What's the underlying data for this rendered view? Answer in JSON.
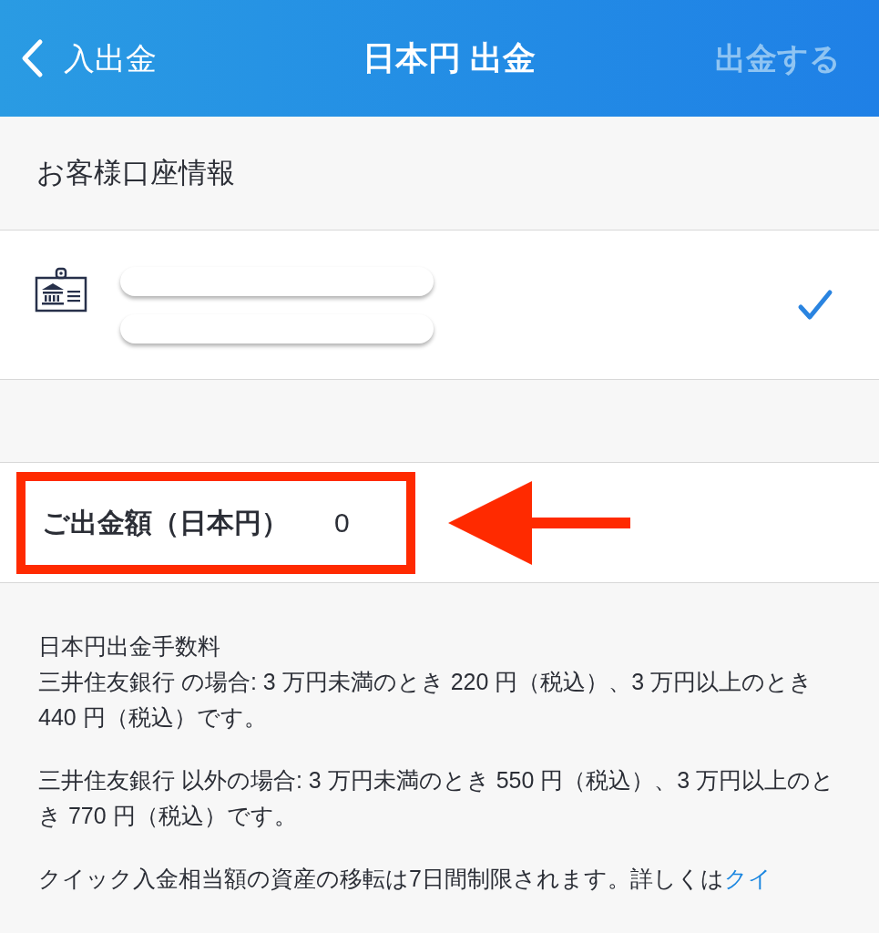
{
  "header": {
    "back_label": "入出金",
    "title": "日本円 出金",
    "action": {
      "label": "出金する",
      "disabled": true
    }
  },
  "section_title": "お客様口座情報",
  "account": {
    "selected": true,
    "lines": [
      {
        "kind": "masked"
      },
      {
        "kind": "masked"
      }
    ]
  },
  "amount": {
    "label": "ご出金額（日本円）",
    "value": "0",
    "highlighted": true
  },
  "fees": {
    "title": "日本円出金手数料",
    "paragraphs": [
      {
        "text": "三井住友銀行 の場合: 3 万円未満のとき 220 円（税込）、3 万円以上のとき 440 円（税込）です。"
      },
      {
        "text": "三井住友銀行 以外の場合: 3 万円未満のとき 550 円（税込）、3 万円以上のとき 770 円（税込）です。"
      },
      {
        "text": "クイック入金相当額の資産の移転は7日間制限されます。詳しくは",
        "link": "クイ"
      }
    ]
  }
}
